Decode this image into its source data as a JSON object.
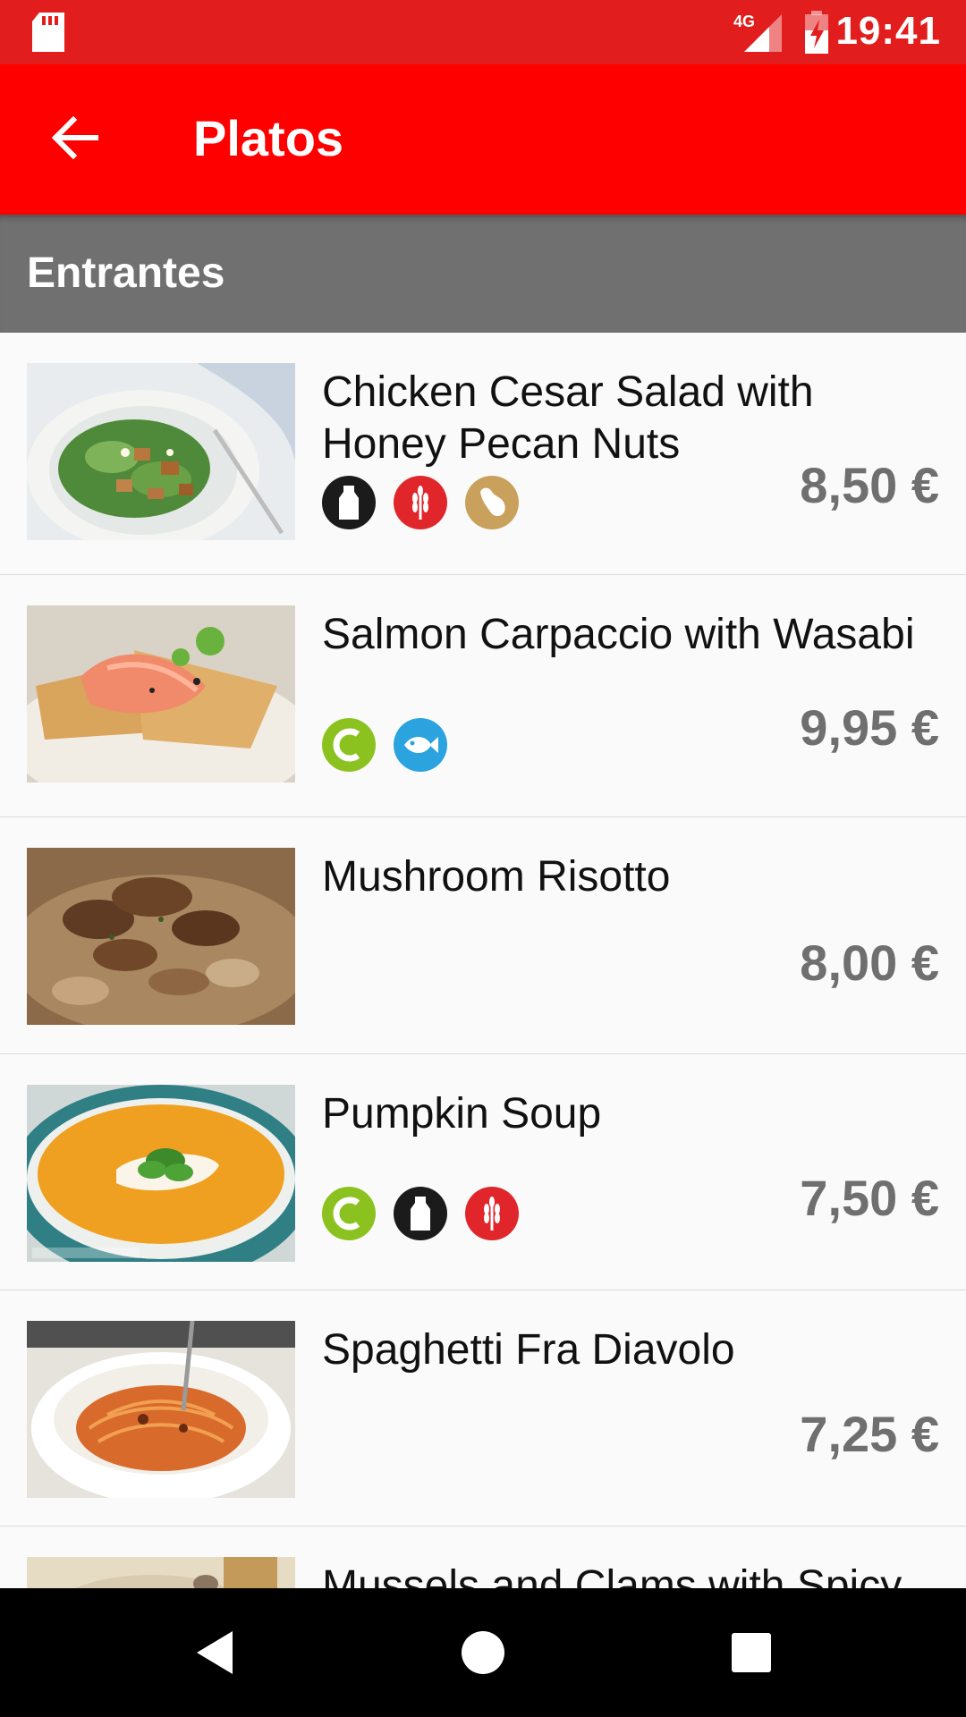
{
  "status_bar": {
    "network": "4G",
    "time": "19:41",
    "icons": [
      "sd-card-icon",
      "signal-4g-icon",
      "battery-charging-icon"
    ]
  },
  "app_bar": {
    "title": "Platos",
    "back_icon": "arrow-back-icon"
  },
  "section": {
    "title": "Entrantes"
  },
  "dishes": [
    {
      "name": "Chicken Cesar Salad with Honey Pecan Nuts",
      "price": "8,50 €",
      "allergens": [
        "milk",
        "gluten",
        "peanuts"
      ]
    },
    {
      "name": "Salmon Carpaccio with Wasabi",
      "price": "9,95 €",
      "allergens": [
        "celery",
        "fish"
      ]
    },
    {
      "name": "Mushroom Risotto",
      "price": "8,00 €",
      "allergens": []
    },
    {
      "name": "Pumpkin Soup",
      "price": "7,50 €",
      "allergens": [
        "celery",
        "milk",
        "gluten"
      ]
    },
    {
      "name": "Spaghetti Fra Diavolo",
      "price": "7,25 €",
      "allergens": []
    },
    {
      "name": "Mussels and Clams with Spicy",
      "price": "",
      "allergens": []
    }
  ],
  "allergen_colors": {
    "milk": "#1b1b1b",
    "gluten": "#e0262b",
    "peanuts": "#c9a15d",
    "celery": "#8cc220",
    "fish": "#2aa3df"
  },
  "nav_bar": {
    "buttons": [
      "back-triangle-icon",
      "home-circle-icon",
      "recents-square-icon"
    ]
  }
}
